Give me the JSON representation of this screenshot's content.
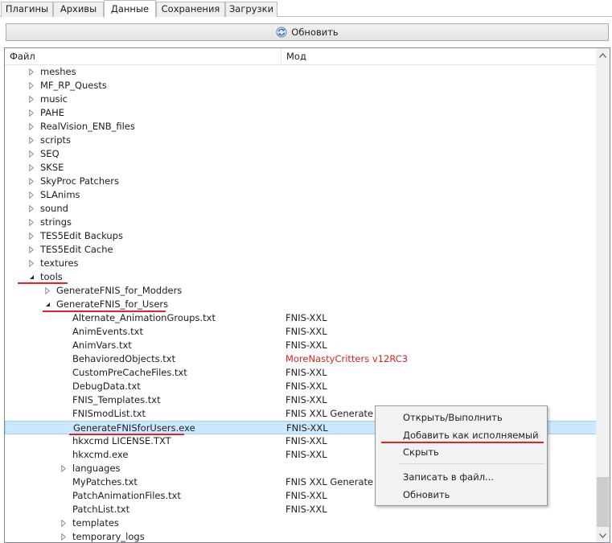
{
  "tabs": [
    {
      "label": "Плагины",
      "active": false
    },
    {
      "label": "Архивы",
      "active": false
    },
    {
      "label": "Данные",
      "active": true
    },
    {
      "label": "Сохранения",
      "active": false
    },
    {
      "label": "Загрузки",
      "active": false
    }
  ],
  "refresh_button": {
    "label": "Обновить",
    "icon": "refresh-icon"
  },
  "columns": {
    "file": "Файл",
    "mod": "Мод"
  },
  "rows": [
    {
      "name": "meshes",
      "mod": "",
      "depth": 0,
      "expander": "collapsed"
    },
    {
      "name": "MF_RP_Quests",
      "mod": "",
      "depth": 0,
      "expander": "collapsed"
    },
    {
      "name": "music",
      "mod": "",
      "depth": 0,
      "expander": "collapsed"
    },
    {
      "name": "PAHE",
      "mod": "",
      "depth": 0,
      "expander": "collapsed"
    },
    {
      "name": "RealVision_ENB_files",
      "mod": "",
      "depth": 0,
      "expander": "collapsed"
    },
    {
      "name": "scripts",
      "mod": "",
      "depth": 0,
      "expander": "collapsed"
    },
    {
      "name": "SEQ",
      "mod": "",
      "depth": 0,
      "expander": "collapsed"
    },
    {
      "name": "SKSE",
      "mod": "",
      "depth": 0,
      "expander": "collapsed"
    },
    {
      "name": "SkyProc Patchers",
      "mod": "",
      "depth": 0,
      "expander": "collapsed"
    },
    {
      "name": "SLAnims",
      "mod": "",
      "depth": 0,
      "expander": "collapsed"
    },
    {
      "name": "sound",
      "mod": "",
      "depth": 0,
      "expander": "collapsed"
    },
    {
      "name": "strings",
      "mod": "",
      "depth": 0,
      "expander": "collapsed"
    },
    {
      "name": "TES5Edit Backups",
      "mod": "",
      "depth": 0,
      "expander": "collapsed"
    },
    {
      "name": "TES5Edit Cache",
      "mod": "",
      "depth": 0,
      "expander": "collapsed"
    },
    {
      "name": "textures",
      "mod": "",
      "depth": 0,
      "expander": "collapsed"
    },
    {
      "name": "tools",
      "mod": "",
      "depth": 0,
      "expander": "expanded"
    },
    {
      "name": "GenerateFNIS_for_Modders",
      "mod": "",
      "depth": 1,
      "expander": "collapsed"
    },
    {
      "name": "GenerateFNIS_for_Users",
      "mod": "",
      "depth": 1,
      "expander": "expanded"
    },
    {
      "name": "Alternate_AnimationGroups.txt",
      "mod": "FNIS-XXL",
      "depth": 2,
      "expander": "none"
    },
    {
      "name": "AnimEvents.txt",
      "mod": "FNIS-XXL",
      "depth": 2,
      "expander": "none"
    },
    {
      "name": "AnimVars.txt",
      "mod": "FNIS-XXL",
      "depth": 2,
      "expander": "none"
    },
    {
      "name": "BehavioredObjects.txt",
      "mod": "MoreNastyCritters v12RC3",
      "depth": 2,
      "expander": "none",
      "mod_color": "#d9241f"
    },
    {
      "name": "CustomPreCacheFiles.txt",
      "mod": "FNIS-XXL",
      "depth": 2,
      "expander": "none"
    },
    {
      "name": "DebugData.txt",
      "mod": "FNIS-XXL",
      "depth": 2,
      "expander": "none"
    },
    {
      "name": "FNIS_Templates.txt",
      "mod": "FNIS-XXL",
      "depth": 2,
      "expander": "none"
    },
    {
      "name": "FNISmodList.txt",
      "mod": "FNIS XXL Generate",
      "depth": 2,
      "expander": "none"
    },
    {
      "name": "GenerateFNISforUsers.exe",
      "mod": "FNIS-XXL",
      "depth": 2,
      "expander": "none",
      "selected": true
    },
    {
      "name": "hkxcmd LICENSE.TXT",
      "mod": "FNIS-XXL",
      "depth": 2,
      "expander": "none"
    },
    {
      "name": "hkxcmd.exe",
      "mod": "FNIS-XXL",
      "depth": 2,
      "expander": "none"
    },
    {
      "name": "languages",
      "mod": "",
      "depth": 2,
      "expander": "collapsed"
    },
    {
      "name": "MyPatches.txt",
      "mod": "FNIS XXL Generate",
      "depth": 2,
      "expander": "none"
    },
    {
      "name": "PatchAnimationFiles.txt",
      "mod": "FNIS-XXL",
      "depth": 2,
      "expander": "none"
    },
    {
      "name": "PatchList.txt",
      "mod": "FNIS-XXL",
      "depth": 2,
      "expander": "none"
    },
    {
      "name": "templates",
      "mod": "",
      "depth": 2,
      "expander": "collapsed"
    },
    {
      "name": "temporary_logs",
      "mod": "",
      "depth": 2,
      "expander": "collapsed"
    }
  ],
  "context_menu": {
    "items": [
      {
        "label": "Открыть/Выполнить"
      },
      {
        "label": "Добавить как исполняемый"
      },
      {
        "label": "Скрыть"
      },
      {
        "separator": true
      },
      {
        "label": "Записать в файл..."
      },
      {
        "label": "Обновить"
      }
    ]
  },
  "colors": {
    "selection": "#cce8ff",
    "annotation_underline": "#e8202a",
    "mod_conflict": "#d9241f"
  }
}
